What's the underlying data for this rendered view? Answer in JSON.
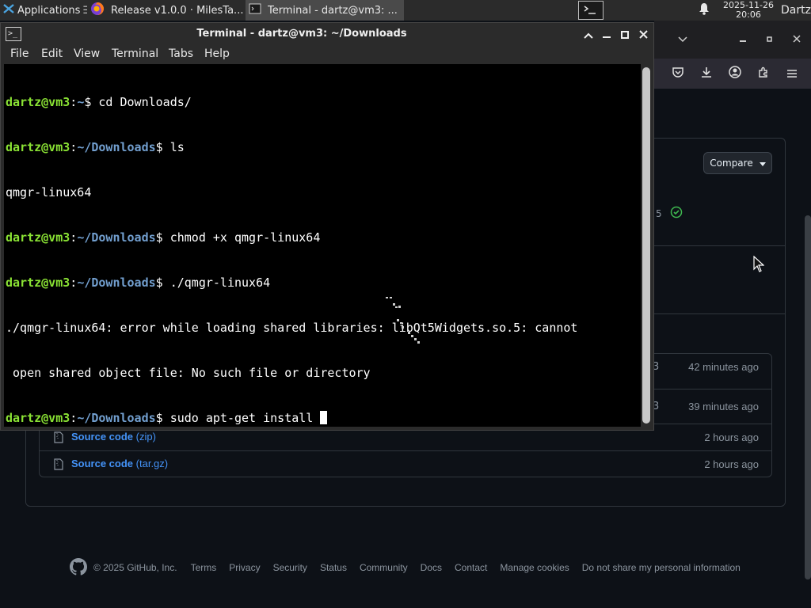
{
  "panel": {
    "apps_label": "Applications",
    "apps_extra": "☰",
    "tasks": [
      {
        "label": "Release v1.0.0 · MilesTa..."
      },
      {
        "label": "Terminal - dartz@vm3: ..."
      }
    ],
    "clock_date": "2025-11-26",
    "clock_time": "20:06",
    "user": "Dartz"
  },
  "terminal": {
    "title": "Terminal - dartz@vm3: ~/Downloads",
    "menu": [
      "File",
      "Edit",
      "View",
      "Terminal",
      "Tabs",
      "Help"
    ],
    "lines": [
      {
        "user": "dartz@vm3",
        "sep": ":",
        "path": "~",
        "dollar": "$ ",
        "cmd": "cd Downloads/"
      },
      {
        "user": "dartz@vm3",
        "sep": ":",
        "path": "~/Downloads",
        "dollar": "$ ",
        "cmd": "ls"
      },
      {
        "text": "qmgr-linux64"
      },
      {
        "user": "dartz@vm3",
        "sep": ":",
        "path": "~/Downloads",
        "dollar": "$ ",
        "cmd": "chmod +x qmgr-linux64"
      },
      {
        "user": "dartz@vm3",
        "sep": ":",
        "path": "~/Downloads",
        "dollar": "$ ",
        "cmd": "./qmgr-linux64"
      },
      {
        "text": "./qmgr-linux64: error while loading shared libraries: libQt5Widgets.so.5: cannot"
      },
      {
        "text": " open shared object file: No such file or directory"
      },
      {
        "user": "dartz@vm3",
        "sep": ":",
        "path": "~/Downloads",
        "dollar": "$ ",
        "cmd": "sudo apt-get install "
      }
    ]
  },
  "browser": {
    "compare_label": "Compare",
    "verified_fragment": "5",
    "assets": [
      {
        "name_fragment": "3",
        "time": "42 minutes ago"
      },
      {
        "name_fragment": "3",
        "time": "39 minutes ago"
      },
      {
        "name": "Source code",
        "ext": "(zip)",
        "time": "2 hours ago"
      },
      {
        "name": "Source code",
        "ext": "(tar.gz)",
        "time": "2 hours ago"
      }
    ],
    "footer": {
      "copyright": "© 2025 GitHub, Inc.",
      "links": [
        "Terms",
        "Privacy",
        "Security",
        "Status",
        "Community",
        "Docs",
        "Contact",
        "Manage cookies",
        "Do not share my personal information"
      ]
    }
  },
  "colors": {
    "prompt_user": "#8ae234",
    "prompt_path": "#729fcf",
    "link": "#4493f8",
    "page_bg": "#0d1117"
  },
  "icons": {
    "panel": [
      "applications-menu-icon",
      "firefox-icon",
      "terminal-icon",
      "terminal-launcher-icon",
      "notification-bell-icon"
    ],
    "browser_toolbar": [
      "pocket-icon",
      "download-icon",
      "account-icon",
      "extensions-icon",
      "hamburger-menu-icon"
    ],
    "terminal_window": [
      "terminal-app-icon",
      "maximize-up-icon",
      "minimize-icon",
      "restore-icon",
      "close-icon"
    ]
  }
}
